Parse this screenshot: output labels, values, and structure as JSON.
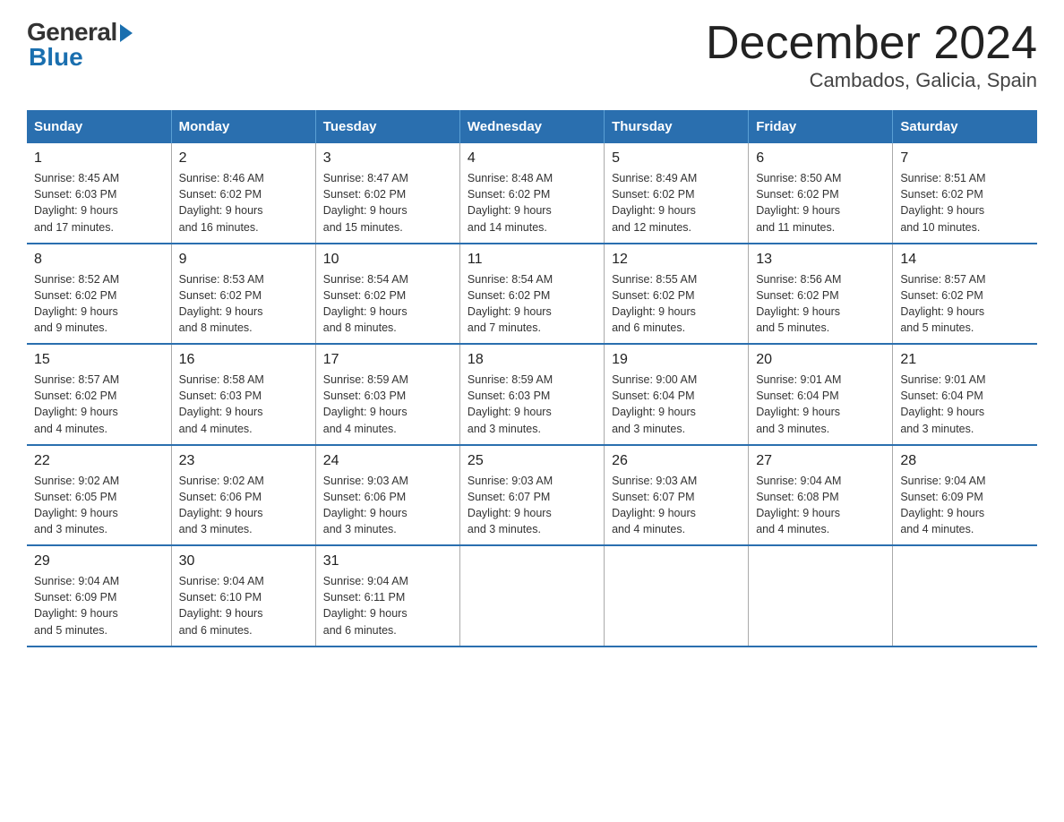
{
  "logo": {
    "general": "General",
    "blue": "Blue"
  },
  "title": "December 2024",
  "location": "Cambados, Galicia, Spain",
  "days_of_week": [
    "Sunday",
    "Monday",
    "Tuesday",
    "Wednesday",
    "Thursday",
    "Friday",
    "Saturday"
  ],
  "weeks": [
    [
      {
        "day": "1",
        "sunrise": "8:45 AM",
        "sunset": "6:03 PM",
        "daylight": "9 hours and 17 minutes."
      },
      {
        "day": "2",
        "sunrise": "8:46 AM",
        "sunset": "6:02 PM",
        "daylight": "9 hours and 16 minutes."
      },
      {
        "day": "3",
        "sunrise": "8:47 AM",
        "sunset": "6:02 PM",
        "daylight": "9 hours and 15 minutes."
      },
      {
        "day": "4",
        "sunrise": "8:48 AM",
        "sunset": "6:02 PM",
        "daylight": "9 hours and 14 minutes."
      },
      {
        "day": "5",
        "sunrise": "8:49 AM",
        "sunset": "6:02 PM",
        "daylight": "9 hours and 12 minutes."
      },
      {
        "day": "6",
        "sunrise": "8:50 AM",
        "sunset": "6:02 PM",
        "daylight": "9 hours and 11 minutes."
      },
      {
        "day": "7",
        "sunrise": "8:51 AM",
        "sunset": "6:02 PM",
        "daylight": "9 hours and 10 minutes."
      }
    ],
    [
      {
        "day": "8",
        "sunrise": "8:52 AM",
        "sunset": "6:02 PM",
        "daylight": "9 hours and 9 minutes."
      },
      {
        "day": "9",
        "sunrise": "8:53 AM",
        "sunset": "6:02 PM",
        "daylight": "9 hours and 8 minutes."
      },
      {
        "day": "10",
        "sunrise": "8:54 AM",
        "sunset": "6:02 PM",
        "daylight": "9 hours and 8 minutes."
      },
      {
        "day": "11",
        "sunrise": "8:54 AM",
        "sunset": "6:02 PM",
        "daylight": "9 hours and 7 minutes."
      },
      {
        "day": "12",
        "sunrise": "8:55 AM",
        "sunset": "6:02 PM",
        "daylight": "9 hours and 6 minutes."
      },
      {
        "day": "13",
        "sunrise": "8:56 AM",
        "sunset": "6:02 PM",
        "daylight": "9 hours and 5 minutes."
      },
      {
        "day": "14",
        "sunrise": "8:57 AM",
        "sunset": "6:02 PM",
        "daylight": "9 hours and 5 minutes."
      }
    ],
    [
      {
        "day": "15",
        "sunrise": "8:57 AM",
        "sunset": "6:02 PM",
        "daylight": "9 hours and 4 minutes."
      },
      {
        "day": "16",
        "sunrise": "8:58 AM",
        "sunset": "6:03 PM",
        "daylight": "9 hours and 4 minutes."
      },
      {
        "day": "17",
        "sunrise": "8:59 AM",
        "sunset": "6:03 PM",
        "daylight": "9 hours and 4 minutes."
      },
      {
        "day": "18",
        "sunrise": "8:59 AM",
        "sunset": "6:03 PM",
        "daylight": "9 hours and 3 minutes."
      },
      {
        "day": "19",
        "sunrise": "9:00 AM",
        "sunset": "6:04 PM",
        "daylight": "9 hours and 3 minutes."
      },
      {
        "day": "20",
        "sunrise": "9:01 AM",
        "sunset": "6:04 PM",
        "daylight": "9 hours and 3 minutes."
      },
      {
        "day": "21",
        "sunrise": "9:01 AM",
        "sunset": "6:04 PM",
        "daylight": "9 hours and 3 minutes."
      }
    ],
    [
      {
        "day": "22",
        "sunrise": "9:02 AM",
        "sunset": "6:05 PM",
        "daylight": "9 hours and 3 minutes."
      },
      {
        "day": "23",
        "sunrise": "9:02 AM",
        "sunset": "6:06 PM",
        "daylight": "9 hours and 3 minutes."
      },
      {
        "day": "24",
        "sunrise": "9:03 AM",
        "sunset": "6:06 PM",
        "daylight": "9 hours and 3 minutes."
      },
      {
        "day": "25",
        "sunrise": "9:03 AM",
        "sunset": "6:07 PM",
        "daylight": "9 hours and 3 minutes."
      },
      {
        "day": "26",
        "sunrise": "9:03 AM",
        "sunset": "6:07 PM",
        "daylight": "9 hours and 4 minutes."
      },
      {
        "day": "27",
        "sunrise": "9:04 AM",
        "sunset": "6:08 PM",
        "daylight": "9 hours and 4 minutes."
      },
      {
        "day": "28",
        "sunrise": "9:04 AM",
        "sunset": "6:09 PM",
        "daylight": "9 hours and 4 minutes."
      }
    ],
    [
      {
        "day": "29",
        "sunrise": "9:04 AM",
        "sunset": "6:09 PM",
        "daylight": "9 hours and 5 minutes."
      },
      {
        "day": "30",
        "sunrise": "9:04 AM",
        "sunset": "6:10 PM",
        "daylight": "9 hours and 6 minutes."
      },
      {
        "day": "31",
        "sunrise": "9:04 AM",
        "sunset": "6:11 PM",
        "daylight": "9 hours and 6 minutes."
      },
      null,
      null,
      null,
      null
    ]
  ],
  "labels": {
    "sunrise": "Sunrise:",
    "sunset": "Sunset:",
    "daylight": "Daylight:"
  }
}
